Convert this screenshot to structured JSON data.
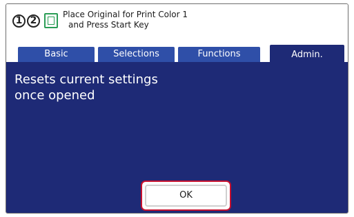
{
  "header": {
    "step_one": "1",
    "step_two": "2",
    "doc_icon": "document-icon",
    "message_line1": "Place Original for Print Color 1",
    "message_line2": "and Press Start Key"
  },
  "tabs": [
    {
      "label": "Basic"
    },
    {
      "label": "Selections"
    },
    {
      "label": "Functions"
    },
    {
      "label": "Admin."
    }
  ],
  "active_tab": "Admin.",
  "panel": {
    "message_line1": "Resets current settings",
    "message_line2": "once opened",
    "ok_label": "OK"
  },
  "colors": {
    "panel_bg": "#1e2a76",
    "tab_bg": "#2f4fa8",
    "highlight": "#c8102e",
    "icon_green": "#2a9d55"
  }
}
